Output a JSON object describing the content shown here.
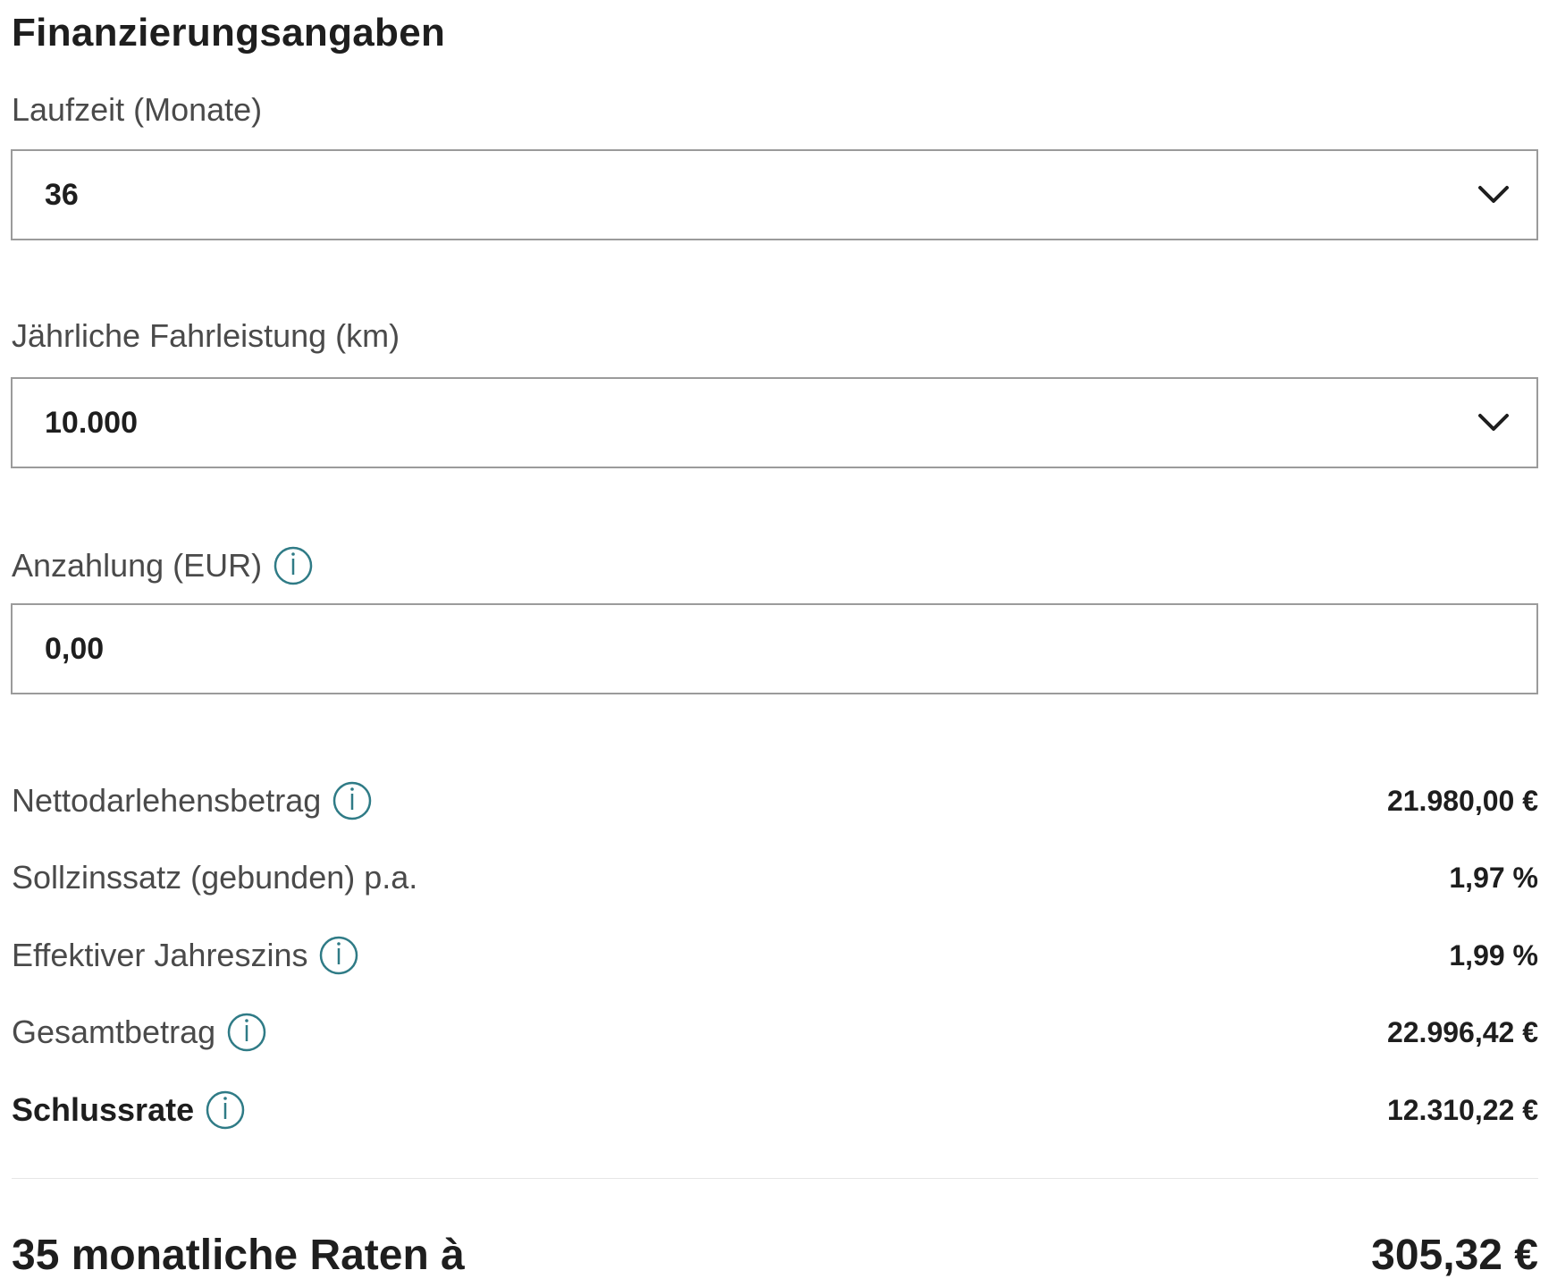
{
  "title": "Finanzierungsangaben",
  "fields": {
    "laufzeit": {
      "label": "Laufzeit (Monate)",
      "value": "36"
    },
    "fahrleistung": {
      "label": "Jährliche Fahrleistung (km)",
      "value": "10.000"
    },
    "anzahlung": {
      "label": "Anzahlung (EUR)",
      "value": "0,00"
    }
  },
  "summary": [
    {
      "label": "Nettodarlehensbetrag",
      "value": "21.980,00 €"
    },
    {
      "label": "Sollzinssatz (gebunden) p.a.",
      "value": "1,97 %"
    },
    {
      "label": "Effektiver Jahreszins",
      "value": "1,99 %"
    },
    {
      "label": "Gesamtbetrag",
      "value": "22.996,42 €"
    },
    {
      "label": "Schlussrate",
      "value": "12.310,22 €"
    }
  ],
  "total": {
    "label": "35 monatliche Raten à",
    "value": "305,32 €"
  },
  "icons": {
    "chevron": "chevron-down-icon",
    "info": "info-icon"
  },
  "colors": {
    "info_icon": "#2f7b86",
    "border": "#9b9b9b",
    "text_dark": "#1e1e1e",
    "text_label": "#4a4a4a"
  }
}
